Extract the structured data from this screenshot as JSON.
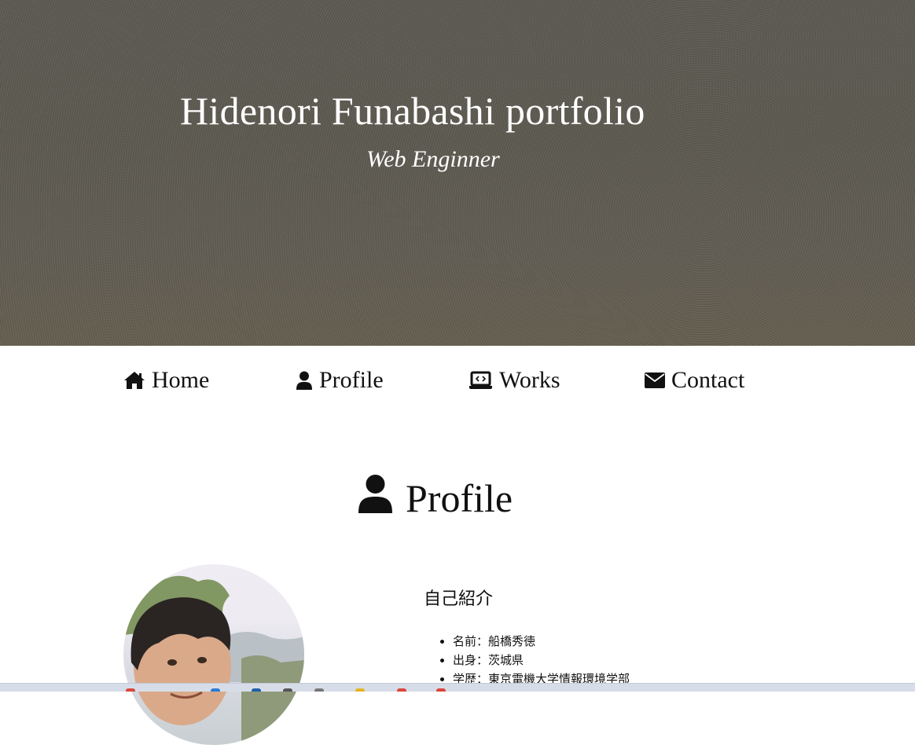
{
  "hero": {
    "title": "Hidenori Funabashi portfolio",
    "subtitle": "Web Enginner"
  },
  "nav": {
    "items": [
      {
        "label": "Home",
        "icon": "home-icon"
      },
      {
        "label": "Profile",
        "icon": "user-icon"
      },
      {
        "label": "Works",
        "icon": "laptop-code-icon"
      },
      {
        "label": "Contact",
        "icon": "envelope-icon"
      }
    ]
  },
  "profile": {
    "heading": "Profile",
    "icon": "user-icon",
    "intro_heading": "自己紹介",
    "details": [
      "名前：船橋秀徳",
      "出身：茨城県",
      "学歴：東京電機大学情報環境学部"
    ]
  },
  "colors": {
    "hero_background": "#5d5a51",
    "text": "#111111",
    "hero_text": "#ffffff",
    "taskbar": "#d7dde8"
  }
}
